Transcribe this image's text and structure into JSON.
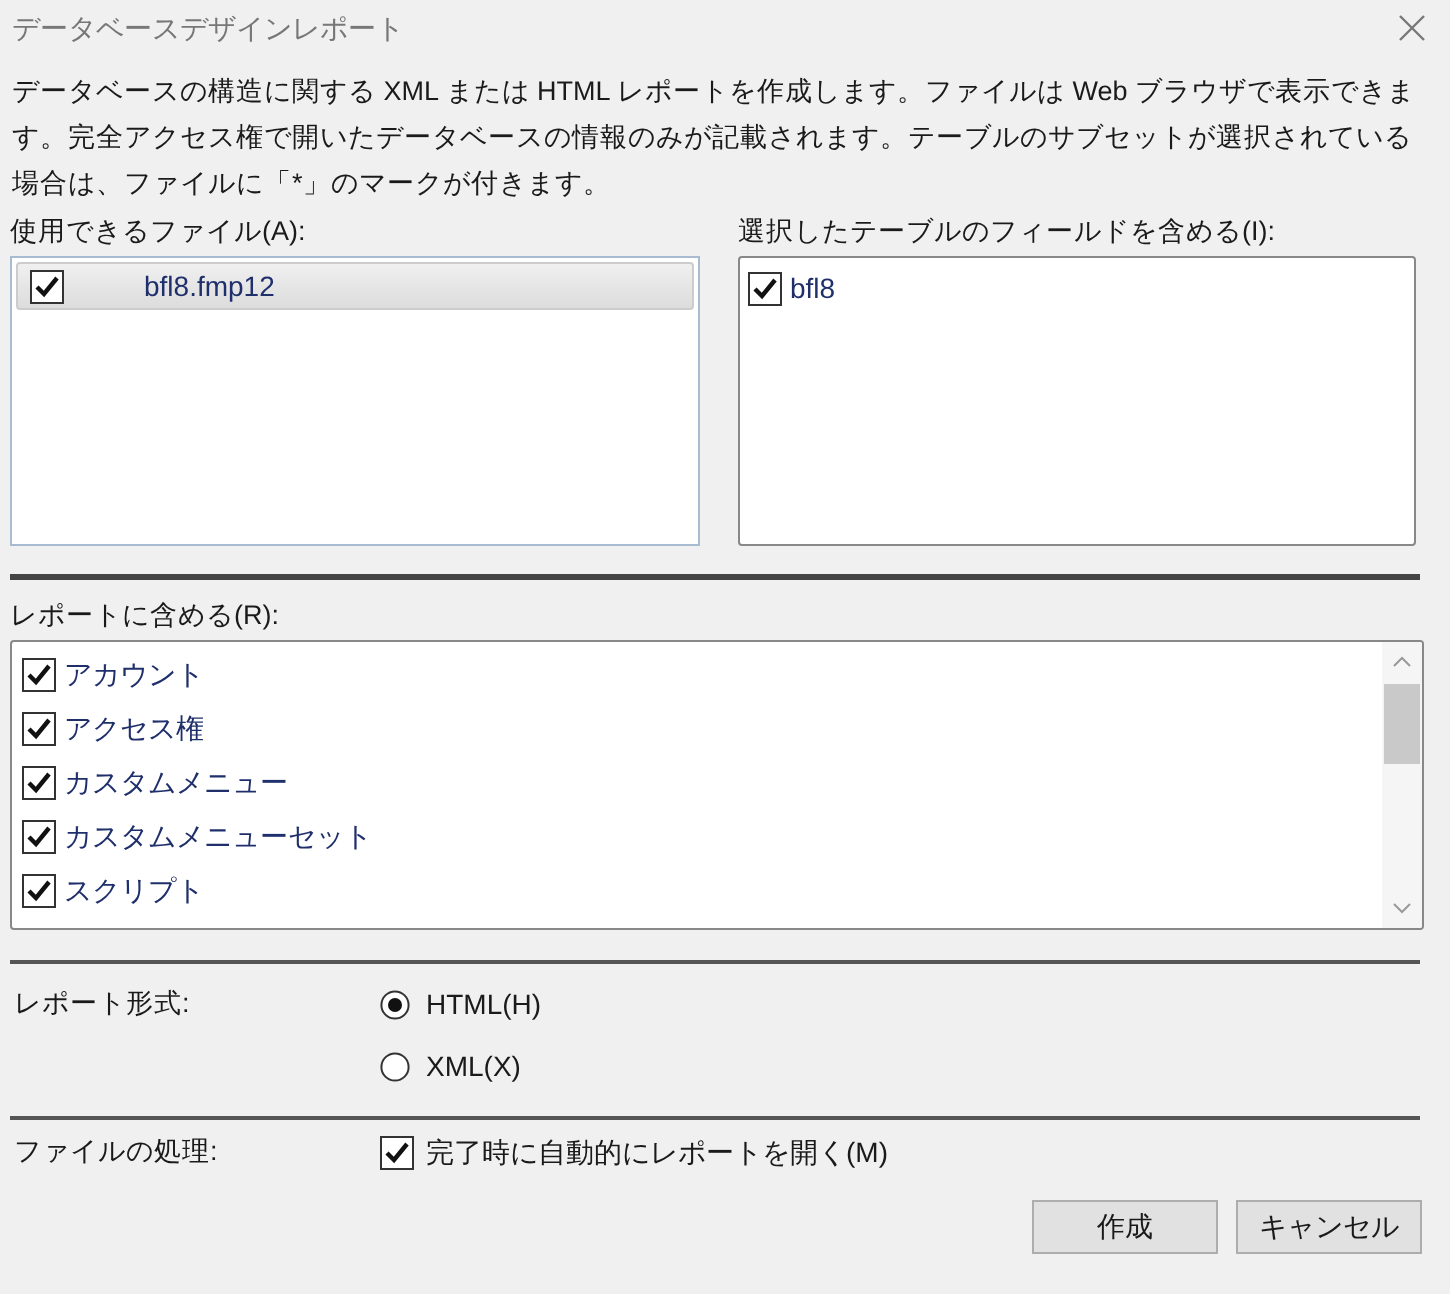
{
  "window": {
    "title": "データベースデザインレポート"
  },
  "description": "データベースの構造に関する XML または HTML レポートを作成します。ファイルは Web ブラウザで表示できます。完全アクセス権で開いたデータベースの情報のみが記載されます。テーブルのサブセットが選択されている場合は、ファイルに「*」のマークが付きます。",
  "available_files": {
    "label": "使用できるファイル(A):",
    "items": [
      {
        "name": "bfl8.fmp12",
        "checked": true,
        "selected": true
      }
    ]
  },
  "table_fields": {
    "label": "選択したテーブルのフィールドを含める(I):",
    "items": [
      {
        "name": "bfl8",
        "checked": true
      }
    ]
  },
  "include_in_report": {
    "label": "レポートに含める(R):",
    "items": [
      {
        "name": "アカウント",
        "checked": true
      },
      {
        "name": "アクセス権",
        "checked": true
      },
      {
        "name": "カスタムメニュー",
        "checked": true
      },
      {
        "name": "カスタムメニューセット",
        "checked": true
      },
      {
        "name": "スクリプト",
        "checked": true
      }
    ]
  },
  "report_format": {
    "label": "レポート形式:",
    "options": [
      {
        "label": "HTML(H)",
        "selected": true
      },
      {
        "label": "XML(X)",
        "selected": false
      }
    ]
  },
  "file_handling": {
    "label": "ファイルの処理:",
    "option": {
      "label": "完了時に自動的にレポートを開く(M)",
      "checked": true
    }
  },
  "buttons": [
    "作成",
    "キャンセル"
  ]
}
